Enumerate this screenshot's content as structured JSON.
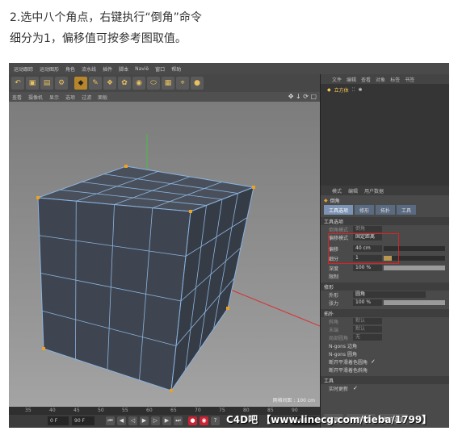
{
  "instructions": {
    "line1": "2.选中八个角点，右键执行“倒角”命令",
    "line2": "细分为1，偏移值可按参考图取值。"
  },
  "menubar": [
    "运动跟踪",
    "运动图形",
    "角色",
    "流水线",
    "插件",
    "脚本",
    "Naviè",
    "窗口",
    "帮助"
  ],
  "viewport": {
    "menu": [
      "查看",
      "摄像机",
      "显示",
      "选项",
      "过滤",
      "面板"
    ],
    "nav_icons": "✥ ↓ ⟳ ▢",
    "footer": "网格间距 : 100 cm"
  },
  "timeline": {
    "ticks": [
      "35",
      "40",
      "45",
      "50",
      "55",
      "60",
      "65",
      "70",
      "75",
      "80",
      "85",
      "90"
    ],
    "frame_field": "90 F",
    "start_field": "0 F",
    "end_field": "90 F"
  },
  "object_manager": {
    "menu": [
      "文件",
      "编辑",
      "查看",
      "对象",
      "标签",
      "书签"
    ],
    "object_name": "立方体"
  },
  "attributes": {
    "menu": [
      "模式",
      "编辑",
      "用户数据"
    ],
    "title": "倒角",
    "tabs": [
      "工具选项",
      "修形",
      "拓扑",
      "工具"
    ],
    "section_tool_options": "工具选项",
    "rows": {
      "bevel_mode": {
        "label": "倒角模式",
        "value": "倒角"
      },
      "offset_mode": {
        "label": "偏移模式",
        "value": "固定距离"
      },
      "offset": {
        "label": "偏移",
        "value": "40 cm"
      },
      "subdivision": {
        "label": "细分",
        "value": "1"
      },
      "depth": {
        "label": "深度",
        "value": "100 %"
      },
      "limit": {
        "label": "限制",
        "value": ""
      }
    },
    "section_shape": "修形",
    "shape_row": {
      "label": "外形",
      "value": "圆角"
    },
    "tension_row": {
      "label": "张力",
      "value": "100 %"
    },
    "section_topology": "拓扑",
    "topology_rows": [
      {
        "label": "斜角",
        "value": "默认"
      },
      {
        "label": "末端",
        "value": "默认"
      },
      {
        "label": "局部圆角",
        "value": "无"
      },
      {
        "label": "N-gons 边角",
        "value": ""
      },
      {
        "label": "N-gons 圆角",
        "value": ""
      },
      {
        "label": "断开平滑着色圆角",
        "value": "✓"
      },
      {
        "label": "断开平滑着色斜角",
        "value": ""
      }
    ],
    "section_tool": "工具",
    "realtime_update": {
      "label": "实时更新",
      "value": "✓"
    },
    "buttons": [
      "应用",
      "新的变换",
      "复位数值"
    ]
  },
  "watermark": "C4D吧 【www.linecg.com/tieba/1799】",
  "colors": {
    "cube_face": "#3e4550",
    "cube_edge": "#8cb4e0",
    "point": "#f0a020",
    "highlight": "#e02020"
  }
}
